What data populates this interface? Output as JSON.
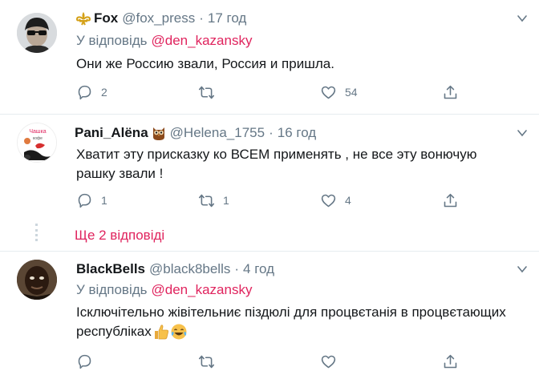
{
  "tweets": [
    {
      "name": "Fox",
      "handle": "@fox_press",
      "dot": "·",
      "time": "17 год",
      "reply_prefix": "У відповідь",
      "reply_mention": "@den_kazansky",
      "text": "Они же Россию звали, Россия и пришла.",
      "replies": "2",
      "retweets": "",
      "likes": "54"
    },
    {
      "name": "Pani_Alёna",
      "handle": "@Helena_1755",
      "dot": "·",
      "time": "16 год",
      "text_line1": "Хватит эту присказку ко ВСЕМ применять , не все эту вонючую",
      "text_line2": "рашку звали !",
      "replies": "1",
      "retweets": "1",
      "likes": "4",
      "more_replies": "Ще 2 відповіді"
    },
    {
      "name": "BlackBells",
      "handle": "@black8bells",
      "dot": "·",
      "time": "4 год",
      "reply_prefix": "У відповідь",
      "reply_mention": "@den_kazansky",
      "text_line1": "Ісключітельно жівітельниє піздюлі для процвєтанія в процвєтающих",
      "text_line2": "республіках"
    }
  ],
  "avatar_labels": {
    "pani_top": "Чашка",
    "pani_mid": "кофе"
  },
  "colors": {
    "accent": "#e0245e",
    "muted": "#657786",
    "separator": "#e6ecf0",
    "verified_gold": "#d4a017"
  }
}
